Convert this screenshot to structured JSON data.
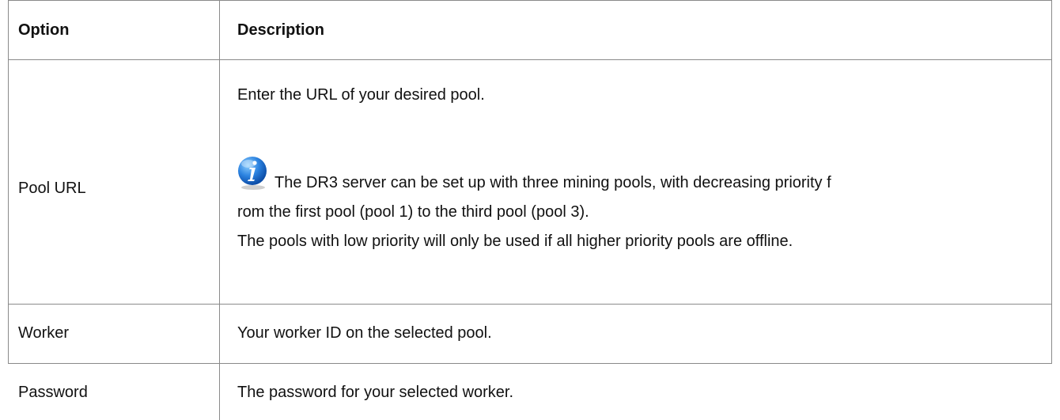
{
  "table": {
    "headers": {
      "option": "Option",
      "description": "Description"
    },
    "rows": [
      {
        "option": "Pool URL",
        "description_lines": [
          "Enter the URL of your desired pool.",
          "The DR3 server can be set up with three mining pools, with decreasing priority f",
          "rom the first pool (pool 1) to the third pool (pool 3).",
          "The pools with low priority will only be used if all higher priority pools are offline."
        ],
        "note_icon": "info-icon"
      },
      {
        "option": "Worker",
        "description": "Your worker ID on the selected pool."
      },
      {
        "option": "Password",
        "description": "The password for your selected worker."
      }
    ]
  },
  "colors": {
    "border": "#8a8a8a",
    "text": "#111111",
    "info_icon_blue": "#1f6fd1"
  }
}
